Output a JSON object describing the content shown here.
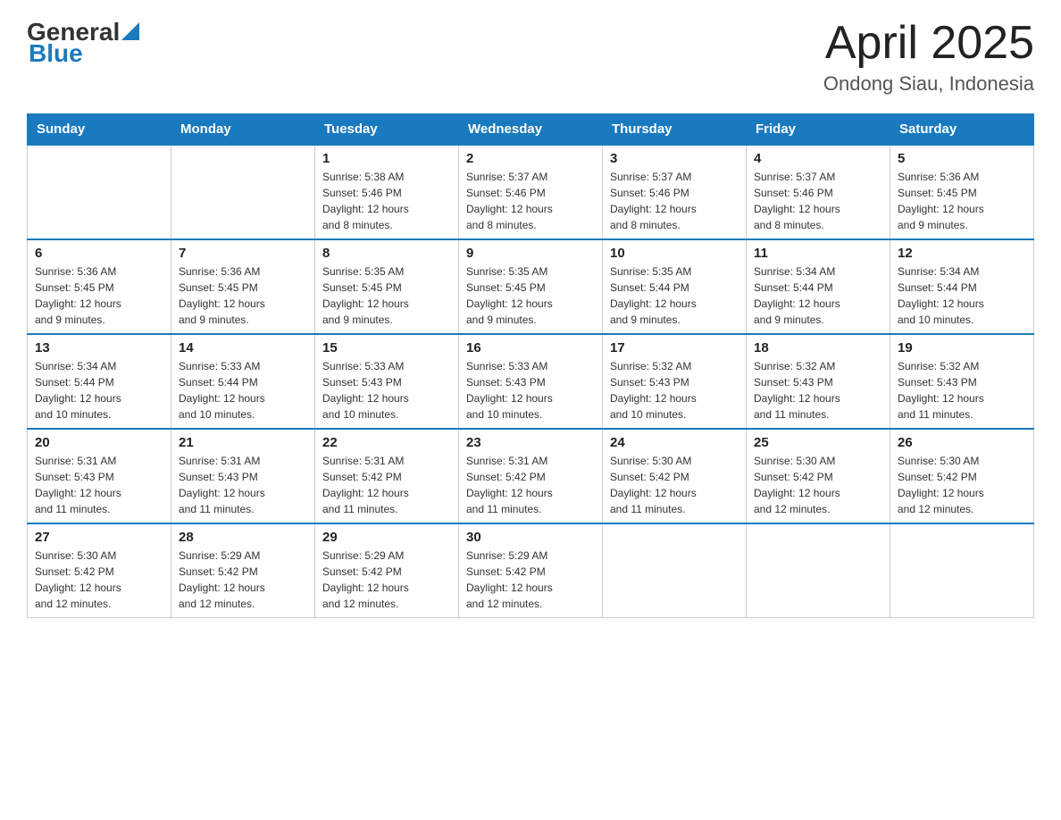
{
  "header": {
    "logo_general": "General",
    "logo_blue": "Blue",
    "month_title": "April 2025",
    "location": "Ondong Siau, Indonesia"
  },
  "weekdays": [
    "Sunday",
    "Monday",
    "Tuesday",
    "Wednesday",
    "Thursday",
    "Friday",
    "Saturday"
  ],
  "weeks": [
    [
      {
        "day": "",
        "info": ""
      },
      {
        "day": "",
        "info": ""
      },
      {
        "day": "1",
        "info": "Sunrise: 5:38 AM\nSunset: 5:46 PM\nDaylight: 12 hours\nand 8 minutes."
      },
      {
        "day": "2",
        "info": "Sunrise: 5:37 AM\nSunset: 5:46 PM\nDaylight: 12 hours\nand 8 minutes."
      },
      {
        "day": "3",
        "info": "Sunrise: 5:37 AM\nSunset: 5:46 PM\nDaylight: 12 hours\nand 8 minutes."
      },
      {
        "day": "4",
        "info": "Sunrise: 5:37 AM\nSunset: 5:46 PM\nDaylight: 12 hours\nand 8 minutes."
      },
      {
        "day": "5",
        "info": "Sunrise: 5:36 AM\nSunset: 5:45 PM\nDaylight: 12 hours\nand 9 minutes."
      }
    ],
    [
      {
        "day": "6",
        "info": "Sunrise: 5:36 AM\nSunset: 5:45 PM\nDaylight: 12 hours\nand 9 minutes."
      },
      {
        "day": "7",
        "info": "Sunrise: 5:36 AM\nSunset: 5:45 PM\nDaylight: 12 hours\nand 9 minutes."
      },
      {
        "day": "8",
        "info": "Sunrise: 5:35 AM\nSunset: 5:45 PM\nDaylight: 12 hours\nand 9 minutes."
      },
      {
        "day": "9",
        "info": "Sunrise: 5:35 AM\nSunset: 5:45 PM\nDaylight: 12 hours\nand 9 minutes."
      },
      {
        "day": "10",
        "info": "Sunrise: 5:35 AM\nSunset: 5:44 PM\nDaylight: 12 hours\nand 9 minutes."
      },
      {
        "day": "11",
        "info": "Sunrise: 5:34 AM\nSunset: 5:44 PM\nDaylight: 12 hours\nand 9 minutes."
      },
      {
        "day": "12",
        "info": "Sunrise: 5:34 AM\nSunset: 5:44 PM\nDaylight: 12 hours\nand 10 minutes."
      }
    ],
    [
      {
        "day": "13",
        "info": "Sunrise: 5:34 AM\nSunset: 5:44 PM\nDaylight: 12 hours\nand 10 minutes."
      },
      {
        "day": "14",
        "info": "Sunrise: 5:33 AM\nSunset: 5:44 PM\nDaylight: 12 hours\nand 10 minutes."
      },
      {
        "day": "15",
        "info": "Sunrise: 5:33 AM\nSunset: 5:43 PM\nDaylight: 12 hours\nand 10 minutes."
      },
      {
        "day": "16",
        "info": "Sunrise: 5:33 AM\nSunset: 5:43 PM\nDaylight: 12 hours\nand 10 minutes."
      },
      {
        "day": "17",
        "info": "Sunrise: 5:32 AM\nSunset: 5:43 PM\nDaylight: 12 hours\nand 10 minutes."
      },
      {
        "day": "18",
        "info": "Sunrise: 5:32 AM\nSunset: 5:43 PM\nDaylight: 12 hours\nand 11 minutes."
      },
      {
        "day": "19",
        "info": "Sunrise: 5:32 AM\nSunset: 5:43 PM\nDaylight: 12 hours\nand 11 minutes."
      }
    ],
    [
      {
        "day": "20",
        "info": "Sunrise: 5:31 AM\nSunset: 5:43 PM\nDaylight: 12 hours\nand 11 minutes."
      },
      {
        "day": "21",
        "info": "Sunrise: 5:31 AM\nSunset: 5:43 PM\nDaylight: 12 hours\nand 11 minutes."
      },
      {
        "day": "22",
        "info": "Sunrise: 5:31 AM\nSunset: 5:42 PM\nDaylight: 12 hours\nand 11 minutes."
      },
      {
        "day": "23",
        "info": "Sunrise: 5:31 AM\nSunset: 5:42 PM\nDaylight: 12 hours\nand 11 minutes."
      },
      {
        "day": "24",
        "info": "Sunrise: 5:30 AM\nSunset: 5:42 PM\nDaylight: 12 hours\nand 11 minutes."
      },
      {
        "day": "25",
        "info": "Sunrise: 5:30 AM\nSunset: 5:42 PM\nDaylight: 12 hours\nand 12 minutes."
      },
      {
        "day": "26",
        "info": "Sunrise: 5:30 AM\nSunset: 5:42 PM\nDaylight: 12 hours\nand 12 minutes."
      }
    ],
    [
      {
        "day": "27",
        "info": "Sunrise: 5:30 AM\nSunset: 5:42 PM\nDaylight: 12 hours\nand 12 minutes."
      },
      {
        "day": "28",
        "info": "Sunrise: 5:29 AM\nSunset: 5:42 PM\nDaylight: 12 hours\nand 12 minutes."
      },
      {
        "day": "29",
        "info": "Sunrise: 5:29 AM\nSunset: 5:42 PM\nDaylight: 12 hours\nand 12 minutes."
      },
      {
        "day": "30",
        "info": "Sunrise: 5:29 AM\nSunset: 5:42 PM\nDaylight: 12 hours\nand 12 minutes."
      },
      {
        "day": "",
        "info": ""
      },
      {
        "day": "",
        "info": ""
      },
      {
        "day": "",
        "info": ""
      }
    ]
  ]
}
